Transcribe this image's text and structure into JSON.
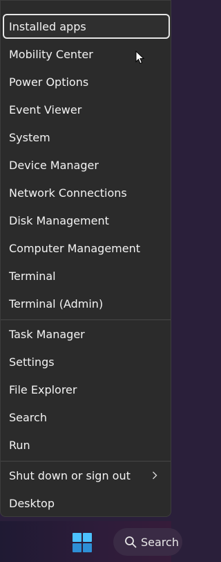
{
  "menu": {
    "items": [
      {
        "label": "Installed apps"
      },
      {
        "label": "Mobility Center"
      },
      {
        "label": "Power Options"
      },
      {
        "label": "Event Viewer"
      },
      {
        "label": "System"
      },
      {
        "label": "Device Manager"
      },
      {
        "label": "Network Connections"
      },
      {
        "label": "Disk Management"
      },
      {
        "label": "Computer Management"
      },
      {
        "label": "Terminal"
      },
      {
        "label": "Terminal (Admin)"
      },
      {
        "label": "Task Manager"
      },
      {
        "label": "Settings"
      },
      {
        "label": "File Explorer"
      },
      {
        "label": "Search"
      },
      {
        "label": "Run"
      },
      {
        "label": "Shut down or sign out"
      },
      {
        "label": "Desktop"
      }
    ]
  },
  "taskbar": {
    "search_label": "Search"
  },
  "colors": {
    "menu_bg": "#2b2b2b",
    "windows_logo": "#4cc2ff",
    "taskbar_bg": "#2e1c3a"
  },
  "icons": [
    "chevron-right-icon",
    "windows-logo-icon",
    "search-icon",
    "mouse-pointer-icon"
  ]
}
